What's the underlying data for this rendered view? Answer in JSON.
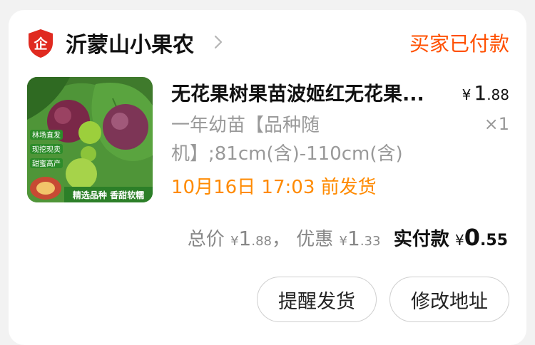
{
  "shop": {
    "name": "沂蒙山小果农",
    "logo_glyph": "企",
    "logo_icon": "shield-logo-icon",
    "chevron_icon": "chevron-right-icon"
  },
  "order": {
    "status": "买家已付款",
    "status_color": "#ff5000"
  },
  "product": {
    "title": "无花果树果苗波姬红无花果...",
    "sku": "一年幼苗【品种随机】;81cm(含)-110cm(含)",
    "price_currency": "¥",
    "price_int": "1",
    "price_dec": ".88",
    "quantity": "×1",
    "ship_notice": "10月16日 17:03 前发货",
    "ship_color": "#ff8a00",
    "thumb_tags": [
      "林场直发",
      "现挖现卖",
      "甜蜜高产"
    ],
    "thumb_banner": "精选品种 香甜软糯"
  },
  "totals": {
    "total_label": "总价",
    "total_currency": "¥",
    "total_int": "1",
    "total_dec": ".88",
    "separator": "，",
    "discount_label": "优惠",
    "discount_currency": "¥",
    "discount_int": "1",
    "discount_dec": ".33",
    "paid_label": "实付款",
    "paid_currency": "¥",
    "paid_int": "0",
    "paid_dec": ".55"
  },
  "actions": {
    "remind_label": "提醒发货",
    "address_label": "修改地址"
  }
}
